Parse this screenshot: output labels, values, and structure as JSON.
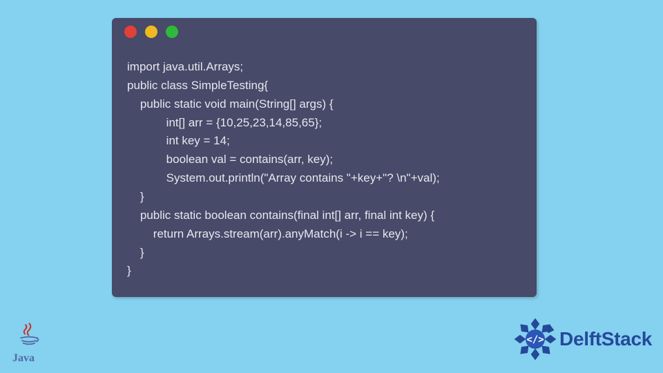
{
  "code": {
    "lines": [
      "import java.util.Arrays;",
      "public class SimpleTesting{",
      "    public static void main(String[] args) {",
      "            int[] arr = {10,25,23,14,85,65};",
      "            int key = 14;",
      "            boolean val = contains(arr, key);",
      "            System.out.println(\"Array contains \"+key+\"? \\n\"+val);",
      "    }",
      "    public static boolean contains(final int[] arr, final int key) {",
      "        return Arrays.stream(arr).anyMatch(i -> i == key);",
      "    }",
      "}"
    ]
  },
  "logos": {
    "java_text": "Java",
    "delft_text": "DelftStack"
  },
  "window_dots": [
    "red",
    "yellow",
    "green"
  ]
}
